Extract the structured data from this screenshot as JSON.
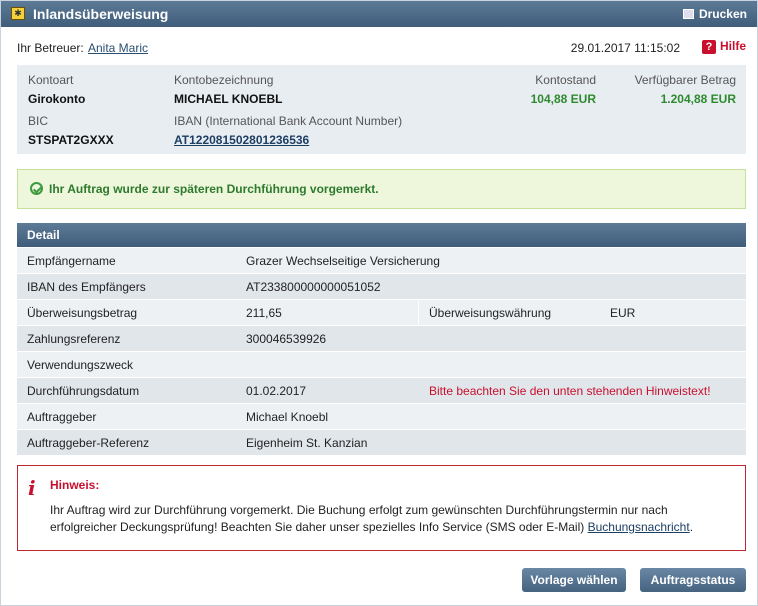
{
  "window": {
    "title": "Inlandsüberweisung",
    "print_label": "Drucken"
  },
  "header": {
    "betreuer_label": "Ihr Betreuer:",
    "betreuer_name": "Anita Maric",
    "datetime": "29.01.2017 11:15:02",
    "help_label": "Hilfe"
  },
  "account": {
    "kontoart_label": "Kontoart",
    "kontoart_value": "Girokonto",
    "bezeichnung_label": "Kontobezeichnung",
    "bezeichnung_value": "MICHAEL KNOEBL",
    "kontostand_label": "Kontostand",
    "kontostand_value": "104,88 EUR",
    "verfuegbar_label": "Verfügbarer Betrag",
    "verfuegbar_value": "1.204,88 EUR",
    "bic_label": "BIC",
    "bic_value": "STSPAT2GXXX",
    "iban_label": "IBAN (International Bank Account Number)",
    "iban_value": "AT122081502801236536",
    "amount_color": "#2e8a2e"
  },
  "success": {
    "message": "Ihr Auftrag wurde zur späteren Durchführung vorgemerkt."
  },
  "detail": {
    "header": "Detail",
    "rows": {
      "empfaenger_label": "Empfängername",
      "empfaenger_value": "Grazer Wechselseitige Versicherung",
      "iban_label": "IBAN des Empfängers",
      "iban_value": "AT233800000000051052",
      "betrag_label": "Überweisungsbetrag",
      "betrag_value": "211,65",
      "waehrung_label": "Überweisungswährung",
      "waehrung_value": "EUR",
      "referenz_label": "Zahlungsreferenz",
      "referenz_value": "300046539926",
      "zweck_label": "Verwendungszweck",
      "zweck_value": "",
      "datum_label": "Durchführungsdatum",
      "datum_value": "01.02.2017",
      "datum_note": "Bitte beachten Sie den unten stehenden Hinweistext!",
      "auftraggeber_label": "Auftraggeber",
      "auftraggeber_value": "Michael Knoebl",
      "ag_referenz_label": "Auftraggeber-Referenz",
      "ag_referenz_value": "Eigenheim St. Kanzian"
    }
  },
  "hint": {
    "title": "Hinweis:",
    "text": "Ihr Auftrag wird zur Durchführung vorgemerkt. Die Buchung erfolgt zum gewünschten Durchführungstermin nur nach erfolgreicher Deckungsprüfung! Beachten Sie daher unser spezielles Info Service (SMS oder E-Mail)",
    "link": "Buchungsnachricht",
    "suffix": "."
  },
  "buttons": {
    "vorlage": "Vorlage wählen",
    "status": "Auftragsstatus"
  },
  "colors": {
    "accent": "#4a6886",
    "warning": "#c8102e",
    "success": "#2e7a2e"
  },
  "icons": {
    "title": "transfer-icon",
    "print": "printer-icon",
    "help": "help-icon",
    "success": "check-circle-icon",
    "hint": "info-icon"
  }
}
